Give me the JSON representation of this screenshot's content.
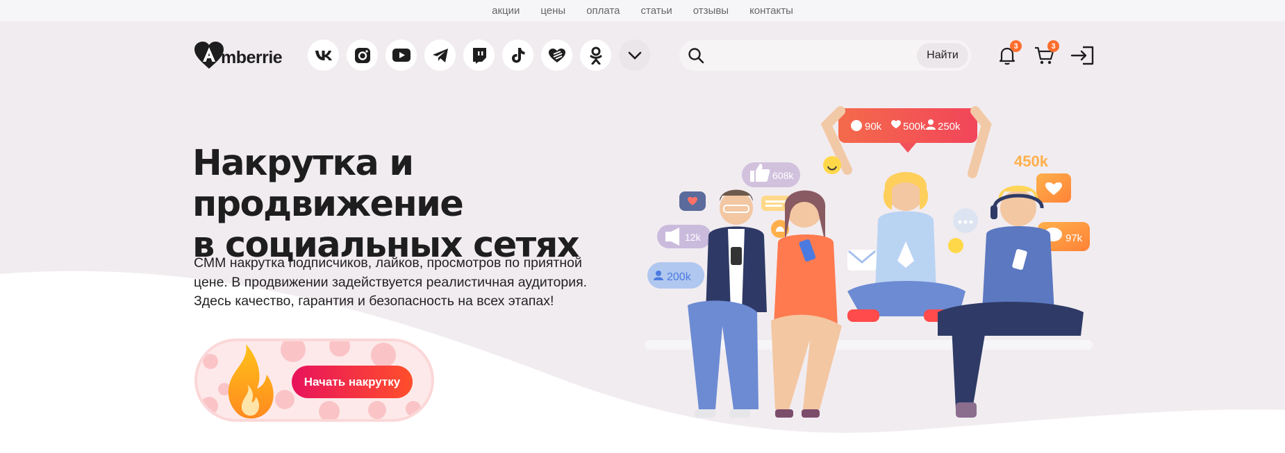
{
  "topnav": [
    "акции",
    "цены",
    "оплата",
    "статьи",
    "отзывы",
    "контакты"
  ],
  "brand": {
    "name": "mberrie"
  },
  "social_icons": [
    "vk-icon",
    "instagram-icon",
    "youtube-icon",
    "telegram-icon",
    "twitch-icon",
    "tiktok-icon",
    "likee-icon",
    "odnoklassniki-icon",
    "chevron-down-icon"
  ],
  "search": {
    "placeholder": "",
    "button": "Найти"
  },
  "notifications": {
    "count": "3"
  },
  "cart": {
    "count": "3"
  },
  "hero": {
    "title_line1": "Накрутка и продвижение",
    "title_line2": "в социальных сетях",
    "desc_line1": "СММ накрутка подписчиков, лайков, просмотров по приятной",
    "desc_line2": "цене. В продвижении задействуется реалистичная аудитория.",
    "desc_line3": "Здесь качество, гарантия и безопасность на всех этапах!",
    "cta": "Начать накрутку"
  },
  "illustration": {
    "banner": {
      "comments": "90k",
      "likes": "500k",
      "followers": "250k"
    },
    "likes_badge": "608k",
    "views_badge": "12k",
    "users_badge": "200k",
    "hearts_count": "450k",
    "comments_badge": "97k"
  },
  "colors": {
    "accent_start": "#e8135c",
    "accent_end": "#ff4f2b",
    "hero_bg": "#f1ecf0",
    "badge": "#ff6d2d"
  }
}
